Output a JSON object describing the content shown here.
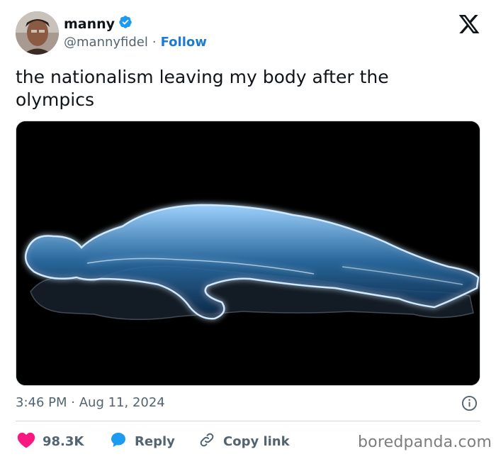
{
  "tweet": {
    "author_name": "manny",
    "handle": "@mannyfidel",
    "separator": "·",
    "follow_label": "Follow",
    "text": "the nationalism leaving my body after the olympics",
    "time": "3:46 PM",
    "date": "Aug 11, 2024",
    "timestamp_separator": "·"
  },
  "actions": {
    "likes": "98.3K",
    "reply": "Reply",
    "copy_link": "Copy link"
  },
  "watermark": "boredpanda.com",
  "colors": {
    "verified": "#1d9bf0",
    "follow": "#1d7bd8",
    "heart": "#f91880",
    "reply_bubble": "#1d9bf0",
    "secondary_text": "#536471",
    "divider": "#cfd9de"
  },
  "icons": {
    "verified": "verified-badge-icon",
    "x_logo": "x-logo-icon",
    "info": "info-icon",
    "heart": "heart-icon",
    "reply": "reply-bubble-icon",
    "link": "link-icon"
  }
}
